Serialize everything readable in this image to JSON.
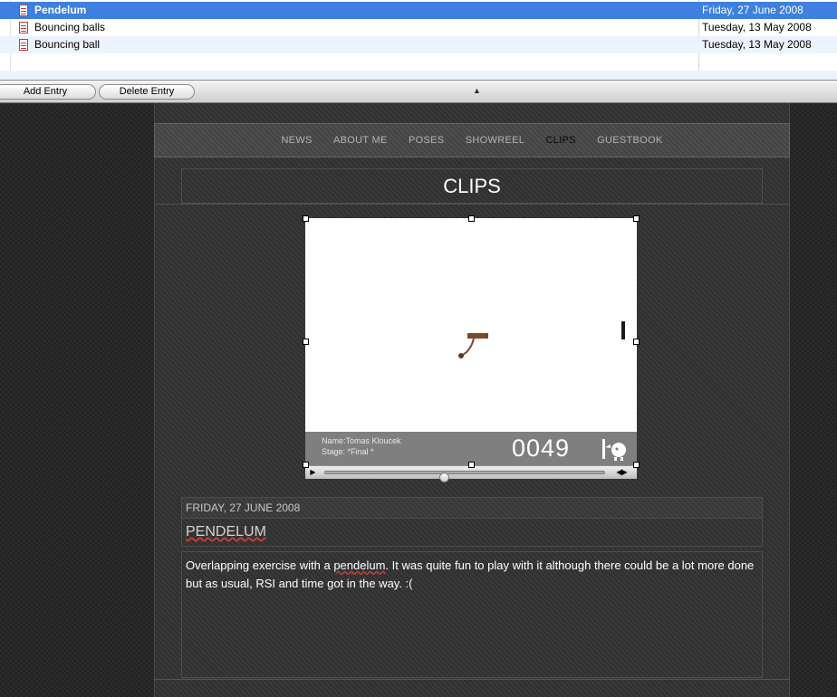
{
  "entries": [
    {
      "title": "Pendelum",
      "date": "Friday, 27 June 2008",
      "selected": true
    },
    {
      "title": "Bouncing balls",
      "date": "Tuesday, 13 May 2008",
      "selected": false
    },
    {
      "title": "Bouncing ball",
      "date": "Tuesday, 13 May 2008",
      "selected": false
    }
  ],
  "toolbar": {
    "add_label": "Add Entry",
    "delete_label": "Delete Entry",
    "collapse_glyph": "▲"
  },
  "nav": {
    "items": [
      "NEWS",
      "ABOUT ME",
      "POSES",
      "SHOWREEL",
      "CLIPS",
      "GUESTBOOK"
    ],
    "active": "CLIPS"
  },
  "page_heading": "CLIPS",
  "movie": {
    "name_label": "Name:Tomas Kloucek",
    "stage_label": "Stage: *Final *",
    "frame_counter": "0049",
    "play_glyph": "▶",
    "step_glyphs": "◀|▶",
    "playback_fraction": 0.35
  },
  "post": {
    "date": "FRIDAY, 27 JUNE 2008",
    "title": "PENDELUM",
    "body_before": "Overlapping exercise with a ",
    "body_flagged_word": "pendelum",
    "body_after": ". It was quite fun to play with it although there could be a lot more done but as usual, RSI and time got in the way. :("
  },
  "colors": {
    "selection": "#3d80df",
    "alt_row": "#edf3fe",
    "page_background": "#242424",
    "spellcheck": "#d94040"
  }
}
